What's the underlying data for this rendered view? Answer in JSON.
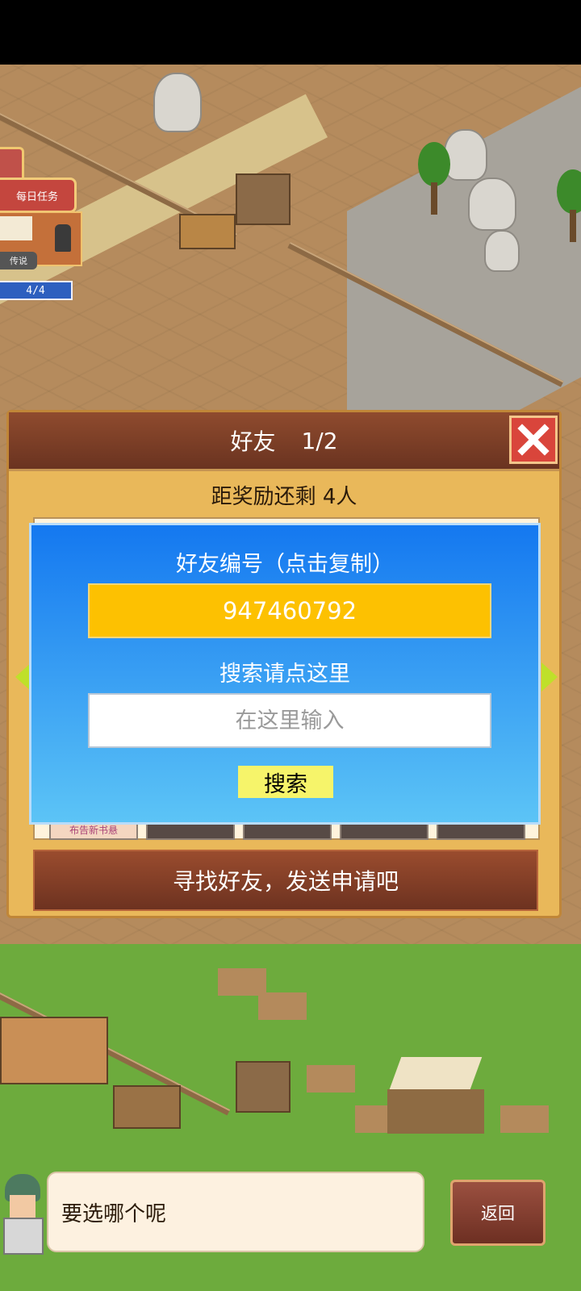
{
  "hud": {
    "daily_quest_label": "每日任务",
    "gossip_label": "传说",
    "counter": "4/4"
  },
  "friend_panel": {
    "title": "好友",
    "page": "1/2",
    "reward_text": "距奖励还剩 4人",
    "find_friends_label": "寻找好友，发送申请吧",
    "first_slot_label": "布告新书悬"
  },
  "friend_id_dialog": {
    "id_label": "好友编号（点击复制）",
    "friend_id": "947460792",
    "search_prompt": "搜索请点这里",
    "search_placeholder": "在这里输入",
    "search_button": "搜索"
  },
  "bottom_bar": {
    "speech_text": "要选哪个呢",
    "back_label": "返回"
  },
  "icons": {
    "close": "close-icon",
    "left_arrow": "arrow-left-icon",
    "right_arrow": "arrow-right-icon"
  },
  "colors": {
    "panel_bg": "#e9b85a",
    "header_brown": "#7a3d26",
    "dialog_blue": "#1478f0",
    "id_yellow": "#fdc101",
    "search_button_yellow": "#f6f46a",
    "close_red": "#d9453b"
  }
}
